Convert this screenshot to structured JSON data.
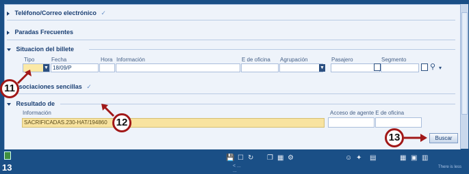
{
  "sections": [
    {
      "label": "Teléfono/Correo electrónico",
      "expanded": false
    },
    {
      "label": "Paradas Frecuentes",
      "expanded": false
    },
    {
      "label": "Situacion del billete",
      "expanded": true
    },
    {
      "label": "Asociaciones sencillas",
      "expanded": false
    },
    {
      "label": "Resultado de",
      "expanded": true
    }
  ],
  "table": {
    "headers": [
      "Tipo",
      "Fecha",
      "Hora",
      "Información",
      "E de oficina",
      "Agrupación",
      "Pasajero",
      "Segmento"
    ],
    "row": {
      "tipo": "",
      "fecha": "18/09/P"
    }
  },
  "info": {
    "label": "Información",
    "value": "SACRIFICADAS.230-HAT/194860",
    "right_label": "Acceso de agente E de oficina"
  },
  "buttons": {
    "search": "Buscar"
  },
  "callouts": [
    "11",
    "12",
    "13"
  ],
  "page_number": "13",
  "status": {
    "line1": "< ...",
    "line2": "...",
    "corner": "There is less"
  }
}
